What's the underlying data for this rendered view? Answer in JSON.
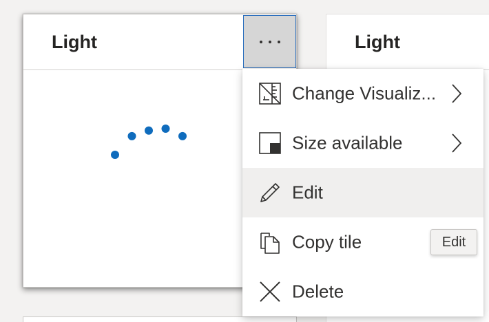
{
  "tiles": [
    {
      "title": "Light"
    },
    {
      "title": "Light"
    }
  ],
  "more_options": {
    "icon": "ellipsis-icon"
  },
  "chart_data": {
    "type": "scatter",
    "title": "",
    "xlabel": "",
    "ylabel": "",
    "x": [
      1,
      2,
      3,
      4,
      5
    ],
    "y": [
      1,
      2,
      2.3,
      2.4,
      2
    ],
    "xlim": [
      1,
      5
    ],
    "ylim": [
      1,
      2.4
    ],
    "grid": false,
    "color": "#0f6cbd"
  },
  "context_menu": {
    "items": [
      {
        "label": "Change Visualiz...",
        "icon": "change-visualization-icon",
        "submenu": true
      },
      {
        "label": "Size available",
        "icon": "size-available-icon",
        "submenu": true
      },
      {
        "label": "Edit",
        "icon": "pencil-icon",
        "submenu": false,
        "highlighted": true
      },
      {
        "label": "Copy tile",
        "icon": "copy-icon",
        "submenu": false
      },
      {
        "label": "Delete",
        "icon": "close-icon",
        "submenu": false
      }
    ]
  },
  "tooltip": {
    "text": "Edit"
  },
  "colors": {
    "accent": "#2a6ebd",
    "marker": "#0f6cbd",
    "menu_hover": "#f0efee"
  }
}
